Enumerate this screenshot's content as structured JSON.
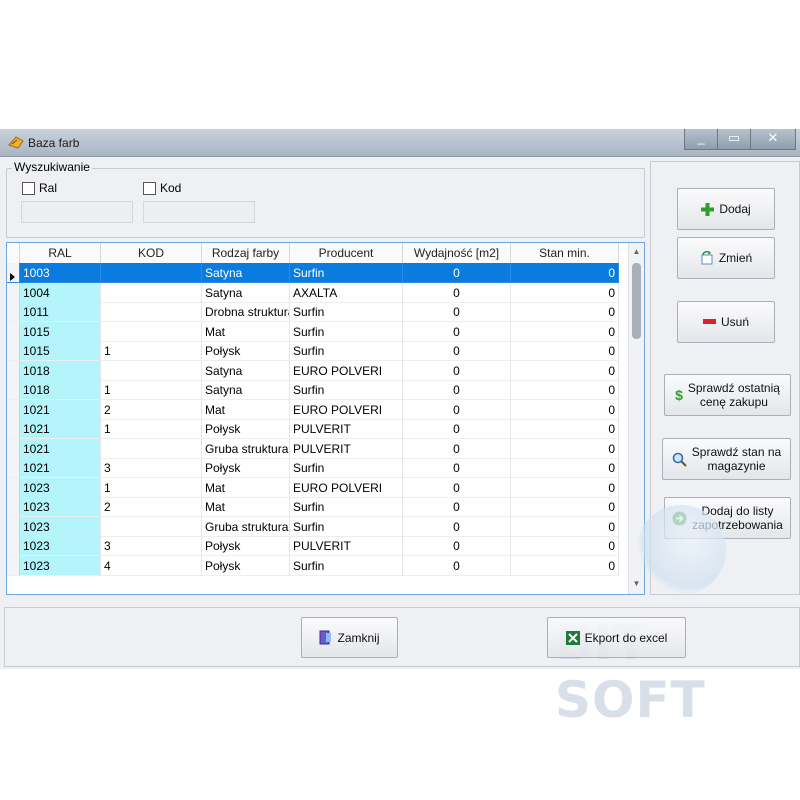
{
  "window": {
    "title": "Baza farb",
    "min_glyph": "_",
    "max_glyph": "▭",
    "close_glyph": "✕"
  },
  "search": {
    "legend": "Wyszukiwanie",
    "ral_label": "Ral",
    "kod_label": "Kod",
    "ral_value": "",
    "kod_value": ""
  },
  "grid": {
    "columns": [
      "RAL",
      "KOD",
      "Rodzaj farby",
      "Producent",
      "Wydajność [m2]",
      "Stan min."
    ],
    "rows": [
      [
        "1003",
        "",
        "Satyna",
        "Surfin",
        "0",
        "0"
      ],
      [
        "1004",
        "",
        "Satyna",
        "AXALTA",
        "0",
        "0"
      ],
      [
        "1011",
        "",
        "Drobna struktura",
        "Surfin",
        "0",
        "0"
      ],
      [
        "1015",
        "",
        "Mat",
        "Surfin",
        "0",
        "0"
      ],
      [
        "1015",
        "1",
        "Połysk",
        "Surfin",
        "0",
        "0"
      ],
      [
        "1018",
        "",
        "Satyna",
        "EURO POLVERI",
        "0",
        "0"
      ],
      [
        "1018",
        "1",
        "Satyna",
        "Surfin",
        "0",
        "0"
      ],
      [
        "1021",
        "2",
        "Mat",
        "EURO POLVERI",
        "0",
        "0"
      ],
      [
        "1021",
        "1",
        "Połysk",
        "PULVERIT",
        "0",
        "0"
      ],
      [
        "1021",
        "",
        "Gruba struktura",
        "PULVERIT",
        "0",
        "0"
      ],
      [
        "1021",
        "3",
        "Połysk",
        "Surfin",
        "0",
        "0"
      ],
      [
        "1023",
        "1",
        "Mat",
        "EURO POLVERI",
        "0",
        "0"
      ],
      [
        "1023",
        "2",
        "Mat",
        "Surfin",
        "0",
        "0"
      ],
      [
        "1023",
        "",
        "Gruba struktura",
        "Surfin",
        "0",
        "0"
      ],
      [
        "1023",
        "3",
        "Połysk",
        "PULVERIT",
        "0",
        "0"
      ],
      [
        "1023",
        "4",
        "Połysk",
        "Surfin",
        "0",
        "0"
      ]
    ],
    "selected_row": 0
  },
  "buttons": {
    "add": "Dodaj",
    "edit": "Zmień",
    "delete": "Usuń",
    "check_price_1": "Sprawdź ostatnią",
    "check_price_2": "cenę zakupu",
    "check_stock_1": "Sprawdź stan na",
    "check_stock_2": "magazynie",
    "add_list_1": "Dodaj do listy",
    "add_list_2": "zapotrzebowania",
    "close": "Zamknij",
    "export": "Ekport do excel"
  },
  "watermark": "BIT SOFT",
  "colors": {
    "selection": "#0a7ce0",
    "ral_column": "#b4f4fb",
    "accent_green": "#2e9e2e",
    "accent_red": "#d9232a"
  }
}
